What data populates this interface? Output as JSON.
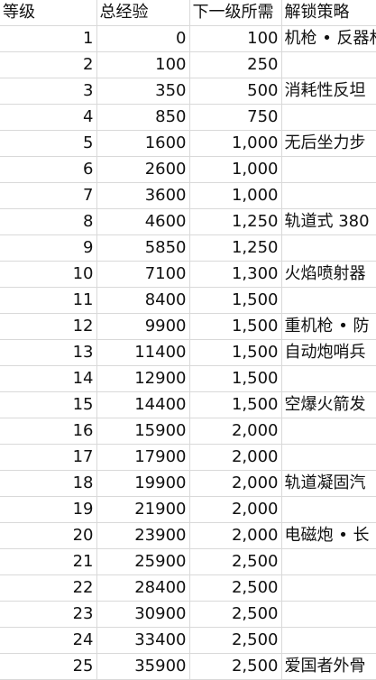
{
  "headers": {
    "level": "等级",
    "total_exp": "总经验",
    "next_level_required": "下一级所需",
    "unlock_strategy": "解锁策略"
  },
  "rows": [
    {
      "level": "1",
      "total_exp": "0",
      "next": "100",
      "strategy": "机枪 • 反器材"
    },
    {
      "level": "2",
      "total_exp": "100",
      "next": "250",
      "strategy": ""
    },
    {
      "level": "3",
      "total_exp": "350",
      "next": "500",
      "strategy": "消耗性反坦"
    },
    {
      "level": "4",
      "total_exp": "850",
      "next": "750",
      "strategy": ""
    },
    {
      "level": "5",
      "total_exp": "1600",
      "next": "1,000",
      "strategy": "无后坐力步"
    },
    {
      "level": "6",
      "total_exp": "2600",
      "next": "1,000",
      "strategy": ""
    },
    {
      "level": "7",
      "total_exp": "3600",
      "next": "1,000",
      "strategy": ""
    },
    {
      "level": "8",
      "total_exp": "4600",
      "next": "1,250",
      "strategy": "轨道式 380"
    },
    {
      "level": "9",
      "total_exp": "5850",
      "next": "1,250",
      "strategy": ""
    },
    {
      "level": "10",
      "total_exp": "7100",
      "next": "1,300",
      "strategy": "火焰喷射器"
    },
    {
      "level": "11",
      "total_exp": "8400",
      "next": "1,500",
      "strategy": ""
    },
    {
      "level": "12",
      "total_exp": "9900",
      "next": "1,500",
      "strategy": "重机枪 • 防"
    },
    {
      "level": "13",
      "total_exp": "11400",
      "next": "1,500",
      "strategy": "自动炮哨兵"
    },
    {
      "level": "14",
      "total_exp": "12900",
      "next": "1,500",
      "strategy": ""
    },
    {
      "level": "15",
      "total_exp": "14400",
      "next": "1,500",
      "strategy": "空爆火箭发"
    },
    {
      "level": "16",
      "total_exp": "15900",
      "next": "2,000",
      "strategy": ""
    },
    {
      "level": "17",
      "total_exp": "17900",
      "next": "2,000",
      "strategy": ""
    },
    {
      "level": "18",
      "total_exp": "19900",
      "next": "2,000",
      "strategy": "轨道凝固汽"
    },
    {
      "level": "19",
      "total_exp": "21900",
      "next": "2,000",
      "strategy": ""
    },
    {
      "level": "20",
      "total_exp": "23900",
      "next": "2,000",
      "strategy": "电磁炮 • 长"
    },
    {
      "level": "21",
      "total_exp": "25900",
      "next": "2,500",
      "strategy": ""
    },
    {
      "level": "22",
      "total_exp": "28400",
      "next": "2,500",
      "strategy": ""
    },
    {
      "level": "23",
      "total_exp": "30900",
      "next": "2,500",
      "strategy": ""
    },
    {
      "level": "24",
      "total_exp": "33400",
      "next": "2,500",
      "strategy": ""
    },
    {
      "level": "25",
      "total_exp": "35900",
      "next": "2,500",
      "strategy": "爱国者外骨"
    }
  ]
}
